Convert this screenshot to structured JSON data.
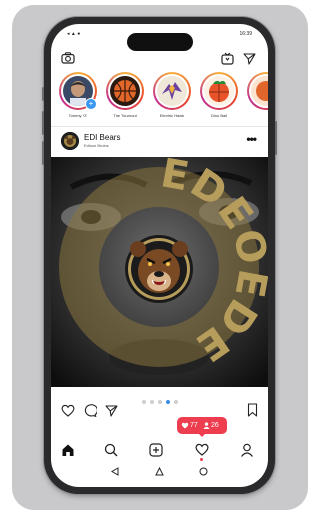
{
  "status_bar": {
    "left_icons": "◂ ▲ ●",
    "time": "16:39",
    "right_icons": "▮▮ ▬"
  },
  "top_bar": {
    "camera": "camera-icon",
    "igtv": "igtv-icon",
    "direct": "direct-message-icon"
  },
  "stories": [
    {
      "name": "Tommy 'G'"
    },
    {
      "name": "The Tournout"
    },
    {
      "name": "Electric Hawk"
    },
    {
      "name": "Dino Ball"
    },
    {
      "name": ""
    }
  ],
  "post": {
    "account": "EDI Bears",
    "subtitle": "Edison Bruins",
    "more": "•••",
    "image_text": "EDEOEDE",
    "carousel_count": 5,
    "carousel_active": 3
  },
  "notification": {
    "likes": "77",
    "followers": "26",
    "colors": {
      "badge": "#ed3d4f"
    }
  },
  "bottom_nav": [
    "home-icon",
    "search-icon",
    "add-post-icon",
    "activity-icon",
    "profile-icon"
  ],
  "system_nav": [
    "back-icon",
    "home-button-icon",
    "recents-icon"
  ]
}
